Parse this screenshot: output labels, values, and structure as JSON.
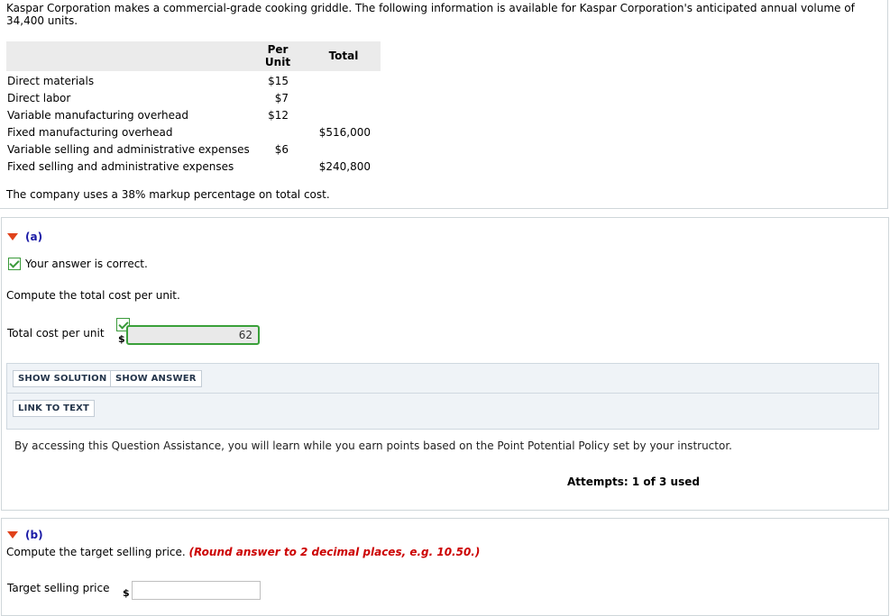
{
  "intro": "Kaspar Corporation makes a commercial-grade cooking griddle. The following information is available for Kaspar Corporation's anticipated annual volume of 34,400 units.",
  "table": {
    "header_per_unit_1": "Per",
    "header_per_unit_2": "Unit",
    "header_total": "Total",
    "rows": [
      {
        "label": "Direct materials",
        "per_unit": "$15",
        "total": ""
      },
      {
        "label": "Direct labor",
        "per_unit": "$7",
        "total": ""
      },
      {
        "label": "Variable manufacturing overhead",
        "per_unit": "$12",
        "total": ""
      },
      {
        "label": "Fixed manufacturing overhead",
        "per_unit": "",
        "total": "$516,000"
      },
      {
        "label": "Variable selling and administrative expenses",
        "per_unit": "$6",
        "total": ""
      },
      {
        "label": "Fixed selling and administrative expenses",
        "per_unit": "",
        "total": "$240,800"
      }
    ]
  },
  "markup_text": "The company uses a 38% markup percentage on total cost.",
  "part_a": {
    "title": "(a)",
    "correct_msg": "Your answer is correct.",
    "question": "Compute the total cost per unit.",
    "field_label": "Total cost per unit",
    "currency": "$",
    "value": "62",
    "show_solution": "SHOW SOLUTION",
    "show_answer": "SHOW ANSWER",
    "link_to_text": "LINK TO TEXT",
    "assist_note": "By accessing this Question Assistance, you will learn while you earn points based on the Point Potential Policy set by your instructor.",
    "attempts": "Attempts: 1 of 3 used"
  },
  "part_b": {
    "title": "(b)",
    "question": "Compute the target selling price.",
    "round_note": "(Round answer to 2 decimal places, e.g. 10.50.)",
    "field_label": "Target selling price",
    "currency": "$",
    "value": ""
  },
  "colors": {
    "accent_green": "#3aa03a",
    "part_title": "#1a1aa6",
    "triangle": "#e0421b",
    "round_note": "#cc0000"
  }
}
